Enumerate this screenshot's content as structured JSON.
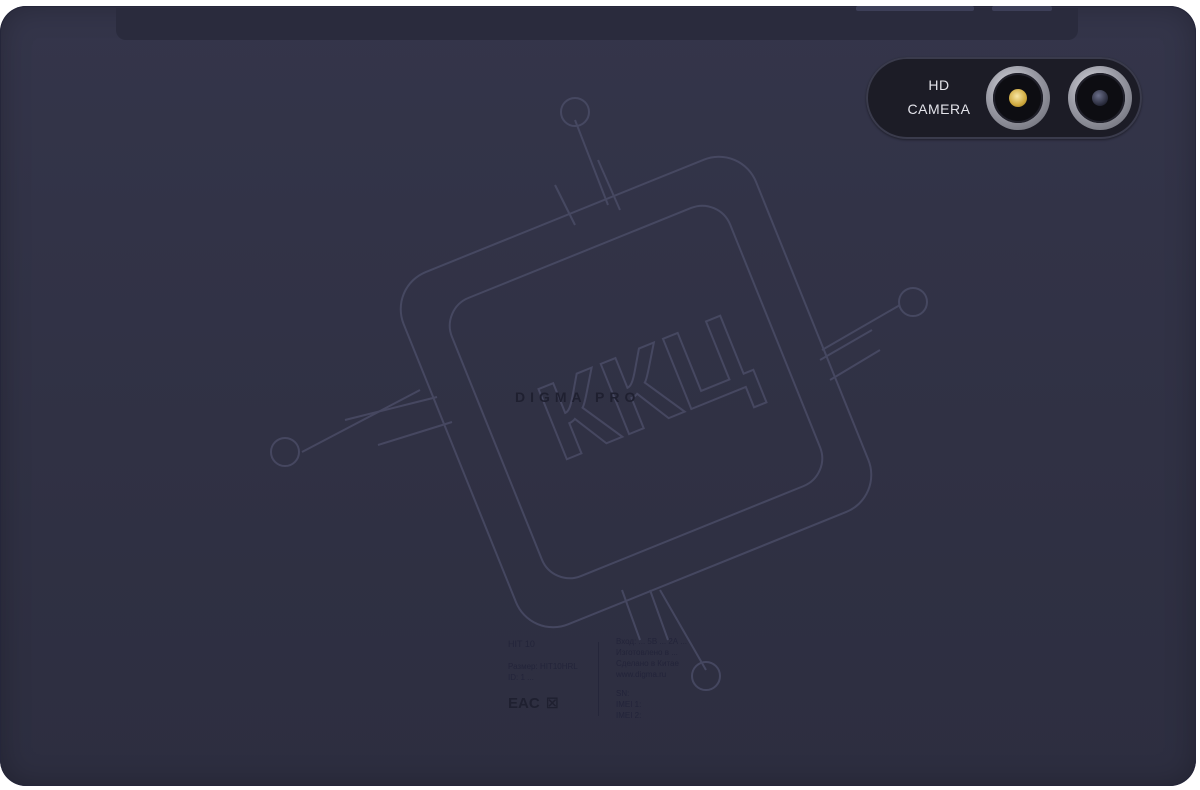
{
  "device": {
    "body_color": "#303144",
    "camera_module": {
      "label_line1": "HD",
      "label_line2": "CAMERA",
      "flash_color": "#e0c060"
    },
    "brand": "DIGMA PRO",
    "watermark": {
      "text": "ККЦ"
    },
    "label": {
      "model": "HIT 10",
      "left_lines": [
        "Размер: HIT10HRL",
        "ID: 1 ..."
      ],
      "cert_eac": "EAC",
      "cert_bin": "☒",
      "right_top_lines": [
        "Вход: ... 5В ... 2А ...",
        "Изготовлено в ...",
        "Сделано в Китае",
        "www.digma.ru"
      ],
      "sn_label": "SN:",
      "imei1_label": "IMEI 1:",
      "imei2_label": "IMEI 2:"
    }
  }
}
